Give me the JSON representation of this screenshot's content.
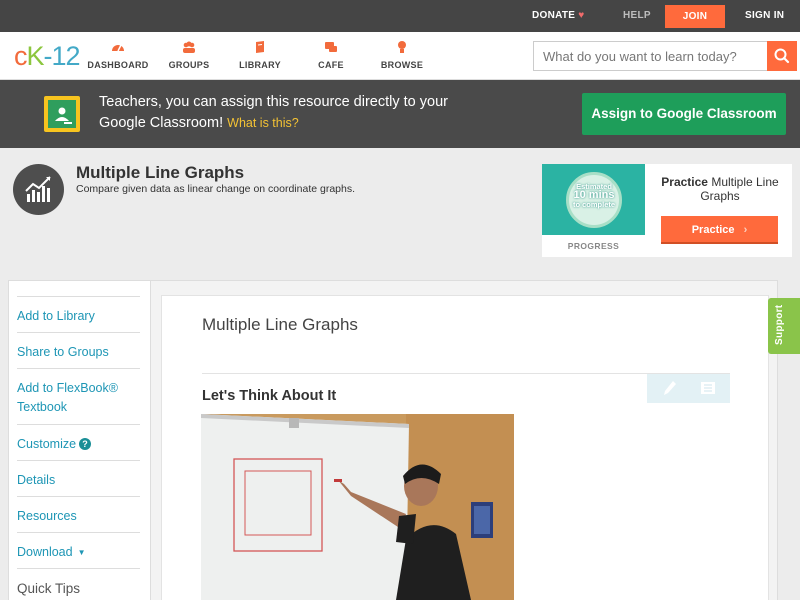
{
  "topbar": {
    "donate": "DONATE",
    "help": "HELP",
    "join": "JOIN",
    "signin": "SIGN IN"
  },
  "logo": {
    "c": "c",
    "k": "K",
    "dash": "-",
    "num": "12"
  },
  "nav": {
    "items": [
      {
        "label": "DASHBOARD",
        "icon": "dashboard-icon"
      },
      {
        "label": "GROUPS",
        "icon": "groups-icon"
      },
      {
        "label": "LIBRARY",
        "icon": "library-icon"
      },
      {
        "label": "CAFE",
        "icon": "cafe-icon"
      },
      {
        "label": "BROWSE",
        "icon": "browse-icon"
      }
    ],
    "search_placeholder": "What do you want to learn today?"
  },
  "banner": {
    "text": "Teachers, you can assign this resource directly to your Google Classroom!",
    "link": "What is this?",
    "button": "Assign to Google Classroom"
  },
  "concept": {
    "title": "Multiple Line Graphs",
    "subtitle": "Compare given data as linear change on coordinate graphs."
  },
  "practice": {
    "progress_line1": "Estimated",
    "progress_line2": "10 mins",
    "progress_line3": "to complete",
    "progress_label": "PROGRESS",
    "title_bold": "Practice",
    "title_rest": "Multiple Line Graphs",
    "button": "Practice"
  },
  "sidebar": {
    "items": [
      {
        "label": "Add to Library"
      },
      {
        "label": "Share to Groups"
      },
      {
        "label": "Add to FlexBook® Textbook"
      },
      {
        "label": "Customize"
      },
      {
        "label": "Details"
      },
      {
        "label": "Resources"
      },
      {
        "label": "Download"
      }
    ],
    "tips": "Quick Tips",
    "customize_help": "?"
  },
  "content": {
    "title": "Multiple Line Graphs",
    "section": "Let's Think About It"
  },
  "support": "Support",
  "colors": {
    "brand_orange": "#ff6a3c",
    "google_green": "#1e9e5a",
    "link_blue": "#1e96b5",
    "support_green": "#8ac44a"
  }
}
